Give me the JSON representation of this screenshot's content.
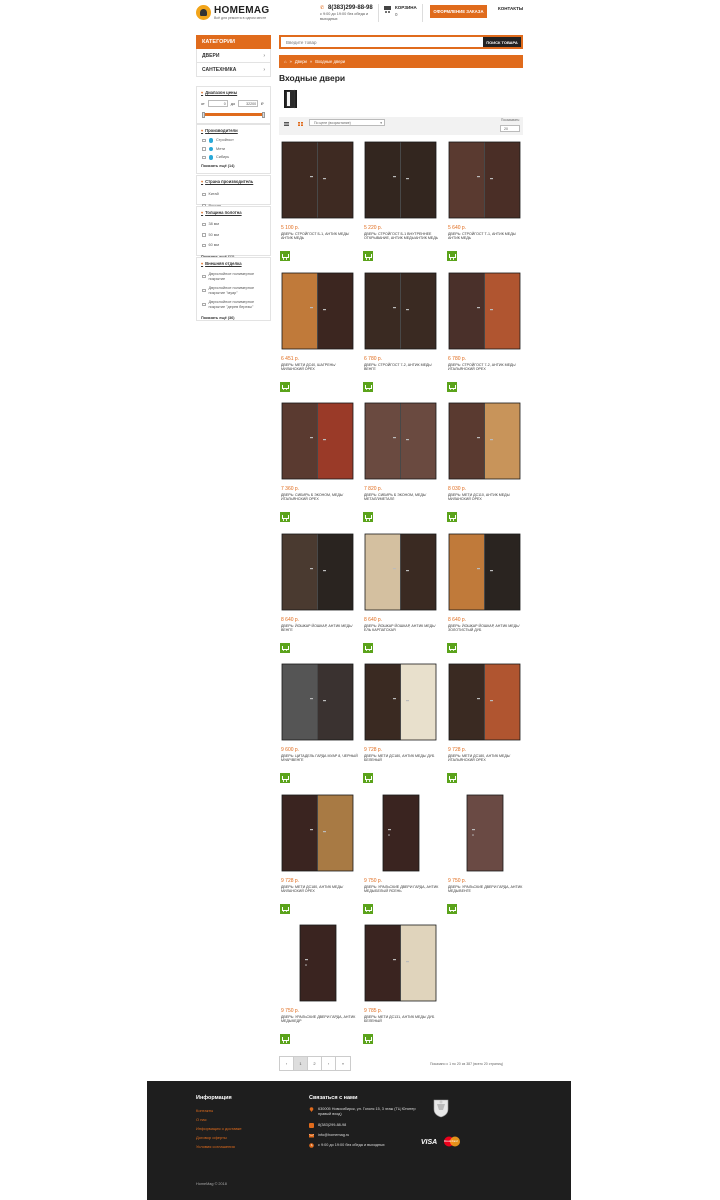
{
  "header": {
    "logo_name": "HOMEMAG",
    "logo_sub": "Всё для ремонта в одном месте",
    "phone": "8(383)299-88-98",
    "phone_hours": "c 9:00 до 19:00 без обеда и выходных",
    "cart_label": "КОРЗИНА",
    "cart_count": "0",
    "checkout_label": "ОФОРМЛЕНИЕ ЗАКАЗА",
    "contacts_label": "КОНТАКТЫ"
  },
  "sidebar": {
    "categories_title": "КАТЕГОРИИ",
    "categories": [
      {
        "label": "ДВЕРИ"
      },
      {
        "label": "САНТЕХНИКА"
      }
    ],
    "price_filter": {
      "title": "Диапазон цены",
      "from_label": "от",
      "to_label": "до",
      "min": "0",
      "max": "32200",
      "currency": "₽"
    },
    "manufacturer": {
      "title": "Производители",
      "options": [
        "Стройгост",
        "Мети",
        "Сибирь"
      ],
      "show_more": "Показать ещё (14)"
    },
    "country": {
      "title": "Страна производитель",
      "options": [
        "Китай",
        "Россия"
      ]
    },
    "thickness": {
      "title": "Толщина полотна",
      "options": [
        "38 мм",
        "50 мм",
        "60 мм"
      ],
      "show_more": "Показать ещё (11)"
    },
    "finish": {
      "title": "Внешняя отделка",
      "options": [
        "Двухслойное полимерное покрытие",
        "Двухслойное полимерное покрытие \"муар\"",
        "Двухслойное полимерное покрытие \"дерев березы\""
      ],
      "show_more": "Показать ещё (36)"
    }
  },
  "search": {
    "placeholder": "Введите товар",
    "button_label": "ПОИСК ТОВАРА"
  },
  "breadcrumbs": {
    "home": "⌂",
    "sep": "»",
    "items": [
      "Двери",
      "Входные двери"
    ]
  },
  "page_title": "Входные двери",
  "toolbar": {
    "sort_value": "По цене (возрастание)",
    "per_page_label": "Показывать:",
    "per_page_value": "20"
  },
  "products": [
    {
      "price": "5 100 р.",
      "name": "ДВЕРЬ: СТРОЙГОСТ Б-1, АНТИК МЕДЬ/АНТИК МЕДЬ",
      "left": "#3e2a22",
      "right": "#3e2a22",
      "double": true
    },
    {
      "price": "5 220 р.",
      "name": "ДВЕРЬ: СТРОЙГОСТ Б-1 ВНУТРЕННЕЕ ОТКРЫВАНИЕ, АНТИК МЕДЬ/АНТИК МЕДЬ",
      "left": "#33261f",
      "right": "#33261f",
      "double": true
    },
    {
      "price": "5 640 р.",
      "name": "ДВЕРЬ: СТРОЙГОСТ Т-1, АНТИК МЕДЬ/АНТИК МЕДЬ",
      "left": "#5a3a30",
      "right": "#4a2e26",
      "double": true
    },
    {
      "price": "6 451 р.",
      "name": "ДВЕРЬ: МЕТИ ДС40, ШАГРЕНЬ/ МИЛАНСКИЙ ОРЕХ",
      "left": "#c07a3a",
      "right": "#3c2620",
      "double": true
    },
    {
      "price": "6 780 р.",
      "name": "ДВЕРЬ: СТРОЙГОСТ 7-2, АНТИК МЕДЬ/ВЕНГЕ",
      "left": "#3a2a22",
      "right": "#3a2a22",
      "double": true
    },
    {
      "price": "6 780 р.",
      "name": "ДВЕРЬ: СТРОЙГОСТ 7-2, АНТИК МЕДЬ/ИТАЛЬЯНСКИЙ ОРЕХ",
      "left": "#4a302a",
      "right": "#b05530",
      "double": true
    },
    {
      "price": "7 360 р.",
      "name": "ДВЕРЬ: СИБИРЬ Б ЭКОНОМ, МЕДЬ/ ИТАЛЬЯНСКИЙ ОРЕХ",
      "left": "#5a3a30",
      "right": "#9a3a28",
      "double": true
    },
    {
      "price": "7 820 р.",
      "name": "ДВЕРЬ: СИБИРЬ Б ЭКОНОМ, МЕДЬ/ МЕТАЛЛ/МЕТАЛЛ",
      "left": "#6a4a40",
      "right": "#6a4a40",
      "double": true
    },
    {
      "price": "8 030 р.",
      "name": "ДВЕРЬ: МЕТИ ДС110, АНТИК МЕДЬ/ МИЛАНСКИЙ ОРЕХ",
      "left": "#5a3a30",
      "right": "#c8945a",
      "double": true
    },
    {
      "price": "8 640 р.",
      "name": "ДВЕРЬ: ЙОШКАР ЙОШКАР, АНТИК МЕДЬ/ВЕНГЕ",
      "left": "#4a3a30",
      "right": "#2a2420",
      "double": true
    },
    {
      "price": "8 640 р.",
      "name": "ДВЕРЬ: ЙОШКАР ЙОШКАР, АНТИК МЕДЬ/ЕЛЬ КАРПАТСКАЯ",
      "left": "#d4c0a0",
      "right": "#3a2a22",
      "double": true
    },
    {
      "price": "8 640 р.",
      "name": "ДВЕРЬ: ЙОШКАР ЙОШКАР, АНТИК МЕДЬ/ЗОЛОТИСТЫЙ ДУБ",
      "left": "#c07a3a",
      "right": "#2a2420",
      "double": true
    },
    {
      "price": "9 600 р.",
      "name": "ДВЕРЬ: ЦИТАДЕЛЬ ГАРДА МУАР 8, ЧЕРНЫЙ МУАР/ВЕНГЕ",
      "left": "#555555",
      "right": "#3a3230",
      "double": true
    },
    {
      "price": "9 728 р.",
      "name": "ДВЕРЬ: МЕТИ ДС180, АНТИК МЕДЬ/ ДУБ БЕЛЕНЫЙ",
      "left": "#3a2a22",
      "right": "#e8e0cc",
      "double": true
    },
    {
      "price": "9 728 р.",
      "name": "ДВЕРЬ: МЕТИ ДС180, АНТИК МЕДЬ/ ИТАЛЬЯНСКИЙ ОРЕХ",
      "left": "#3a2a22",
      "right": "#b05530",
      "double": true
    },
    {
      "price": "9 728 р.",
      "name": "ДВЕРЬ: МЕТИ ДС180, АНТИК МЕДЬ/ МИЛАНСКИЙ ОРЕХ",
      "left": "#3a2420",
      "right": "#a87a44",
      "double": true
    },
    {
      "price": "9 750 р.",
      "name": "ДВЕРЬ: УРАЛЬСКИЕ ДВЕРИ ГАРДА, АНТИК МЕДЬ/БЕЛЫЙ ЯСЕНЬ",
      "left": "#3a2420",
      "right": "#3a2420",
      "double": false
    },
    {
      "price": "9 750 р.",
      "name": "ДВЕРЬ: УРАЛЬСКИЕ ДВЕРИ ГАРДА, АНТИК МЕДЬ/ВЕНГЕ",
      "left": "#6a4a44",
      "right": "#6a4a44",
      "double": false
    },
    {
      "price": "9 750 р.",
      "name": "ДВЕРЬ: УРАЛЬСКИЕ ДВЕРИ ГАРДА, АНТИК МЕДЬ/КЕДР",
      "left": "#3a2420",
      "right": "#3a2420",
      "double": false
    },
    {
      "price": "9 785 р.",
      "name": "ДВЕРЬ: МЕТИ ДС131, АНТИК МЕДЬ/ ДУБ БЕЛЕНЫЙ",
      "left": "#3a2420",
      "right": "#e0d4bc",
      "double": true
    }
  ],
  "pagination": {
    "pages": [
      "‹",
      "1",
      "2",
      "›",
      "»"
    ],
    "info": "Показано с 1 по 20 из 387 (всего 20 страниц)"
  },
  "footer": {
    "info_title": "Информация",
    "links": [
      "Контакты",
      "О нас",
      "Информация о доставке",
      "Договор оферты",
      "Условия соглашения"
    ],
    "contacts_title": "Связаться с нами",
    "address": "630005 Новосибирск, ул. Гоголя 15, 3 этаж (ТЦ Юпитер правый вход)",
    "phone": "8(383)299-88-98",
    "email": "info@homemag.ru",
    "hours": "с 9:00 до 19:00 без обеда и выходных",
    "copyright": "HomeMag © 2018",
    "payments": [
      "VISA",
      "MasterCard"
    ]
  }
}
